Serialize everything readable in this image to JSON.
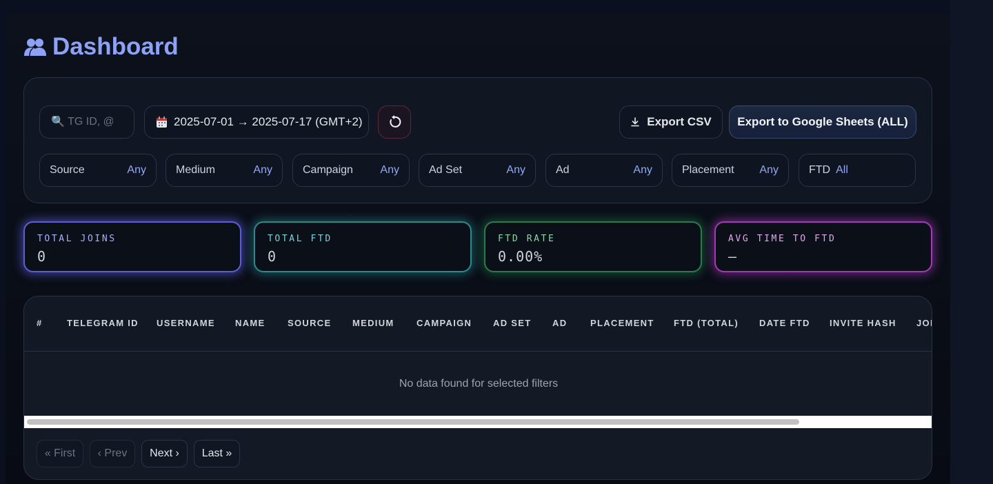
{
  "header": {
    "title": "Dashboard",
    "icon": "users-icon"
  },
  "filters": {
    "search_placeholder": "🔍 TG ID, @use",
    "date_range": "2025-07-01 → 2025-07-17 (GMT+2)",
    "export_csv_label": "Export CSV",
    "export_sheets_label": "Export to Google Sheets (ALL)",
    "selects": [
      {
        "label": "Source",
        "value": "Any"
      },
      {
        "label": "Medium",
        "value": "Any"
      },
      {
        "label": "Campaign",
        "value": "Any"
      },
      {
        "label": "Ad Set",
        "value": "Any"
      },
      {
        "label": "Ad",
        "value": "Any"
      },
      {
        "label": "Placement",
        "value": "Any"
      },
      {
        "label": "FTD",
        "value": "All"
      }
    ]
  },
  "stats": {
    "total_joins": {
      "label": "TOTAL JOINS",
      "value": "0"
    },
    "total_ftd": {
      "label": "TOTAL FTD",
      "value": "0"
    },
    "ftd_rate": {
      "label": "FTD RATE",
      "value": "0.00%"
    },
    "avg_time": {
      "label": "AVG TIME TO FTD",
      "value": "—"
    }
  },
  "table": {
    "columns": [
      "#",
      "TELEGRAM ID",
      "USERNAME",
      "NAME",
      "SOURCE",
      "MEDIUM",
      "CAMPAIGN",
      "AD SET",
      "AD",
      "PLACEMENT",
      "FTD (TOTAL)",
      "DATE FTD",
      "INVITE HASH",
      "JOI"
    ],
    "empty_message": "No data found for selected filters"
  },
  "pagination": {
    "first": "« First",
    "prev": "‹ Prev",
    "next": "Next ›",
    "last": "Last »"
  },
  "colors": {
    "accent": "#8ea2f5",
    "joins": "#5b5fd6",
    "ftd": "#2f8a8a",
    "rate": "#2f7a4c",
    "avg": "#a03bb0"
  }
}
